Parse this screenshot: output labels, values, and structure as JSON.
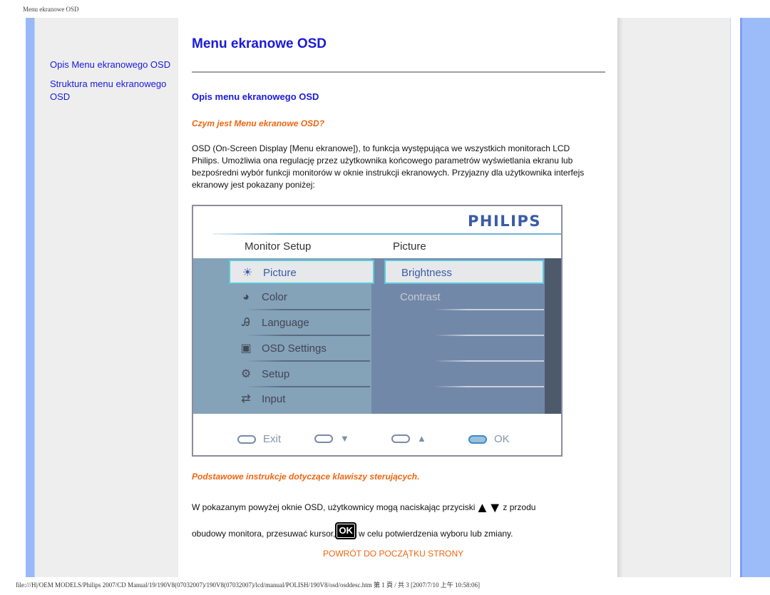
{
  "page_header": "Menu ekranowe OSD",
  "sidebar": {
    "links": [
      {
        "label": "Opis Menu ekranowego OSD"
      },
      {
        "label": "Struktura menu ekranowego OSD"
      }
    ]
  },
  "main": {
    "title": "Menu ekranowe OSD",
    "section_title": "Opis menu ekranowego OSD",
    "question": "Czym jest Menu ekranowe OSD?",
    "intro_paragraph": "OSD (On-Screen Display [Menu ekranowe]), to funkcja występująca we wszystkich monitorach LCD Philips. Umożliwia ona regulację przez użytkownika końcowego parametrów wyświetlania ekranu lub bezpośredni wybór funkcji monitorów w oknie instrukcji ekranowych. Przyjazny dla użytkownika interfejs ekranowy jest pokazany poniżej:",
    "osd_image": {
      "brand": "PHILIPS",
      "left_header": "Monitor Setup",
      "right_header": "Picture",
      "menu_items": [
        {
          "label": "Picture",
          "icon": "sun-icon",
          "glyph": "☀",
          "selected": true
        },
        {
          "label": "Color",
          "icon": "palette-icon",
          "glyph": "◕",
          "selected": false
        },
        {
          "label": "Language",
          "icon": "language-icon",
          "glyph": "Ꭿ",
          "selected": false
        },
        {
          "label": "OSD Settings",
          "icon": "screen-icon",
          "glyph": "▣",
          "selected": false
        },
        {
          "label": "Setup",
          "icon": "gear-icon",
          "glyph": "⚙",
          "selected": false
        },
        {
          "label": "Input",
          "icon": "input-icon",
          "glyph": "⇄",
          "selected": false
        }
      ],
      "submenu_items": [
        {
          "label": "Brightness",
          "selected": true
        },
        {
          "label": "Contrast",
          "selected": false
        },
        {
          "label": "",
          "selected": false
        },
        {
          "label": "",
          "selected": false
        },
        {
          "label": "",
          "selected": false
        },
        {
          "label": ""
        }
      ],
      "buttons": [
        {
          "label": "Exit",
          "symbol": ""
        },
        {
          "label": "",
          "symbol": "▼"
        },
        {
          "label": "",
          "symbol": "▲"
        },
        {
          "label": "OK",
          "symbol": ""
        }
      ]
    },
    "controls_title": "Podstawowe instrukcje dotyczące klawiszy sterujących.",
    "controls_line1_a": "W pokazanym powyżej oknie OSD, użytkownicy mogą naciskając przyciski",
    "controls_arrows": "▲▼",
    "controls_line1_b": " z przodu",
    "controls_line2_a": "obudowy monitora, przesuwać kursor,",
    "controls_ok_key": "OK",
    "controls_line2_b": " w celu potwierdzenia wyboru lub zmiany.",
    "back_to_top": "POWRÓT DO POCZĄTKU STRONY"
  },
  "footer": "file:///H|/OEM MODELS/Philips 2007/CD Manual/19/190V8(07032007)/190V8(07032007)/lcd/manual/POLISH/190V8/osd/osddesc.htm 第 1 頁 / 共 3 [2007/7/10 上午 10:58:06]"
}
